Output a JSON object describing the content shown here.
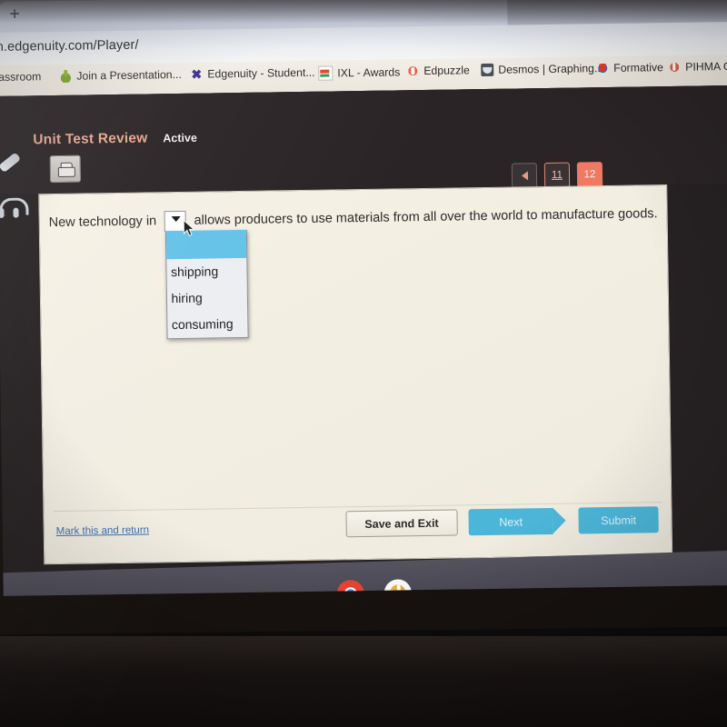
{
  "browser": {
    "new_tab_label": "+",
    "url": "rn.edgenuity.com/Player/",
    "bookmarks": [
      {
        "label": "classroom",
        "icon": "classroom-icon"
      },
      {
        "label": "Join a Presentation...",
        "icon": "nearpod-icon"
      },
      {
        "label": "Edgenuity - Student...",
        "icon": "edgenuity-icon"
      },
      {
        "label": "IXL - Awards",
        "icon": "ixl-icon"
      },
      {
        "label": "Edpuzzle",
        "icon": "edpuzzle-icon"
      },
      {
        "label": "Desmos | Graphing...",
        "icon": "desmos-icon"
      },
      {
        "label": "Formative",
        "icon": "formative-icon"
      },
      {
        "label": "PIHMA C",
        "icon": "pihma-icon"
      }
    ]
  },
  "app": {
    "unit_title": "Unit Test Review",
    "status": "Active",
    "print_icon": "printer-icon",
    "tools": [
      {
        "name": "highlighter-tool",
        "icon": "pencil-icon"
      },
      {
        "name": "audio-tool",
        "icon": "headphones-icon"
      }
    ],
    "pager": {
      "prev_icon": "left-triangle-icon",
      "pages": [
        "11",
        "12"
      ],
      "current": "12"
    }
  },
  "question": {
    "text_before": "New technology in",
    "text_after": "allows producers to use materials from all over the world to manufacture goods.",
    "dropdown": {
      "selected": "",
      "chevron_icon": "chevron-down-icon",
      "options": [
        "",
        "shipping",
        "hiring",
        "consuming"
      ],
      "highlighted_option": ""
    },
    "cursor_icon": "mouse-pointer-icon"
  },
  "footer": {
    "mark_link": "Mark this and return",
    "save_label": "Save and Exit",
    "next_label": "Next",
    "submit_label": "Submit"
  },
  "shelf": {
    "apps": [
      {
        "name": "chrome-app",
        "icon": "chrome-icon"
      },
      {
        "name": "music-app",
        "icon": "music-note-icon"
      }
    ]
  },
  "colors": {
    "accent_blue": "#4cb6d9",
    "highlight_blue": "#64c3e8",
    "page_active_red": "#ef7a61",
    "title_peach": "#e8a68c",
    "card_cream": "#f4efe3"
  }
}
